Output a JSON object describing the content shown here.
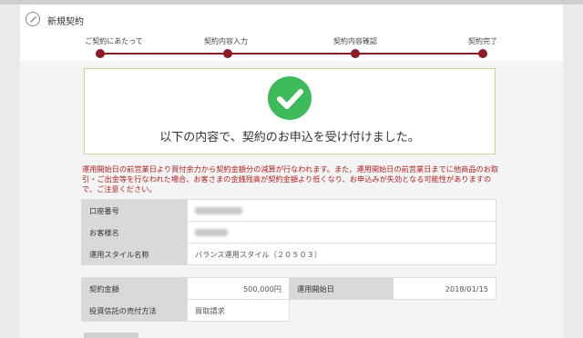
{
  "header": {
    "title": "新規契約"
  },
  "steps": [
    {
      "label": "ご契約にあたって"
    },
    {
      "label": "契約内容入力"
    },
    {
      "label": "契約内容確認"
    },
    {
      "label": "契約完了"
    }
  ],
  "completion": {
    "message": "以下の内容で、契約のお申込を受け付けました。"
  },
  "notice": "運用開始日の前営業日より買付余力から契約金額分の減算が行なわれます。また、運用開始日の前営業日までに他商品のお取引・ご出金等を行なわれた場合、お客さまの金銭残高が契約金額より低くなり、お申込みが失効となる可能性がありますので、ご注意ください。",
  "account": {
    "number_label": "口座番号",
    "name_label": "お客様名",
    "style_label": "運用スタイル名称",
    "style_value": "バランス運用スタイル（２０５０３）"
  },
  "contract": {
    "amount_label": "契約金額",
    "amount_value": "500,000円",
    "start_label": "運用開始日",
    "start_value": "2018/01/15",
    "method_label": "投資信託の売付方法",
    "method_value": "買取請求"
  },
  "colors": {
    "accent": "#8b1e24",
    "success": "#3dbb5a",
    "warning": "#b21f1f"
  }
}
